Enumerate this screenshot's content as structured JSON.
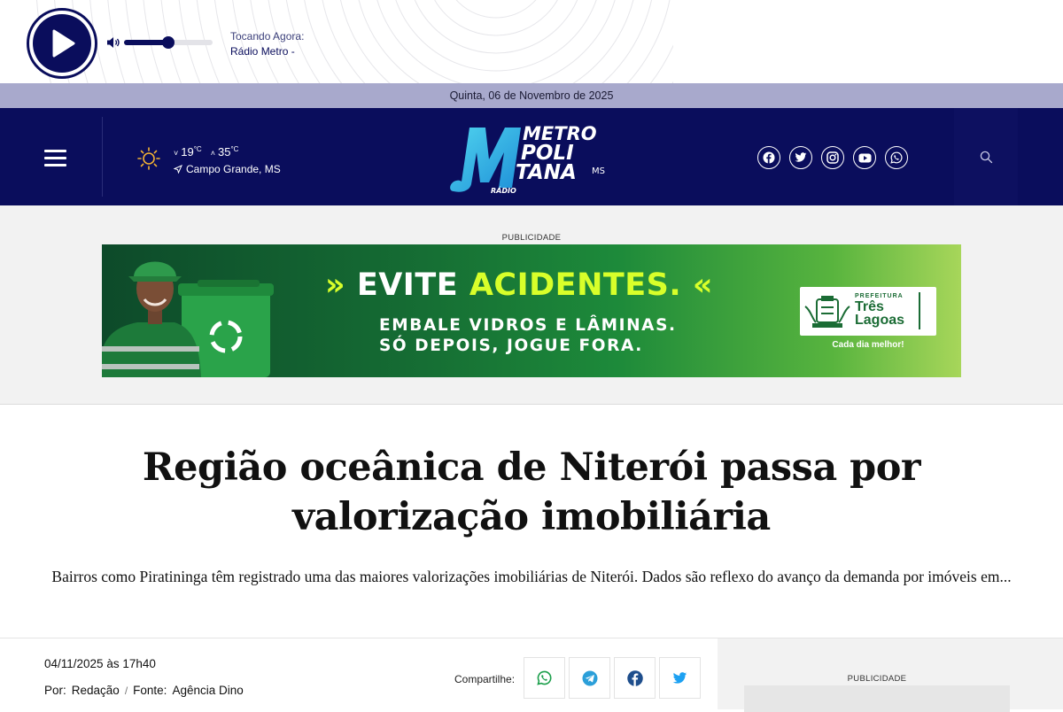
{
  "player": {
    "now_playing_label": "Tocando Agora:",
    "station": "Rádio Metro -",
    "volume_fraction": 0.5
  },
  "datebar": {
    "date": "Quinta, 06 de Novembro de 2025"
  },
  "header": {
    "weather": {
      "min": "19",
      "max": "35",
      "unit": "°C",
      "city": "Campo Grande, MS"
    },
    "logo": {
      "line1": "METRO",
      "line2": "POLI",
      "line3": "TANA",
      "state": "MS",
      "radio": "RÁDIO"
    },
    "socials": [
      "facebook-icon",
      "twitter-icon",
      "instagram-icon",
      "youtube-icon",
      "whatsapp-icon"
    ]
  },
  "ad": {
    "label": "PUBLICIDADE",
    "headline_a": "EVITE",
    "headline_b": "ACIDENTES.",
    "sub_line1": "EMBALE VIDROS E LÂMINAS.",
    "sub_line2": "SÓ DEPOIS, JOGUE FORA.",
    "card_small": "PREFEITURA",
    "card_big": "Três Lagoas",
    "motto": "Cada dia melhor!"
  },
  "article": {
    "title_line1": "Região oceânica de Niterói passa por",
    "title_line2": "valorização imobiliária",
    "summary": "Bairros como Piratininga têm registrado uma das maiores valorizações imobiliárias de Niterói. Dados são reflexo do avanço da demanda por imóveis em...",
    "date": "04/11/2025 às 17h40",
    "by_label": "Por:",
    "author": "Redação",
    "separator": "/",
    "source_label": "Fonte:",
    "source": "Agência Dino",
    "share_label": "Compartilhe:"
  },
  "sidebar": {
    "label": "PUBLICIDADE"
  },
  "colors": {
    "navy": "#0a0d5c",
    "datebar": "#a8a9cc",
    "accent_green": "#d8ff2a"
  }
}
